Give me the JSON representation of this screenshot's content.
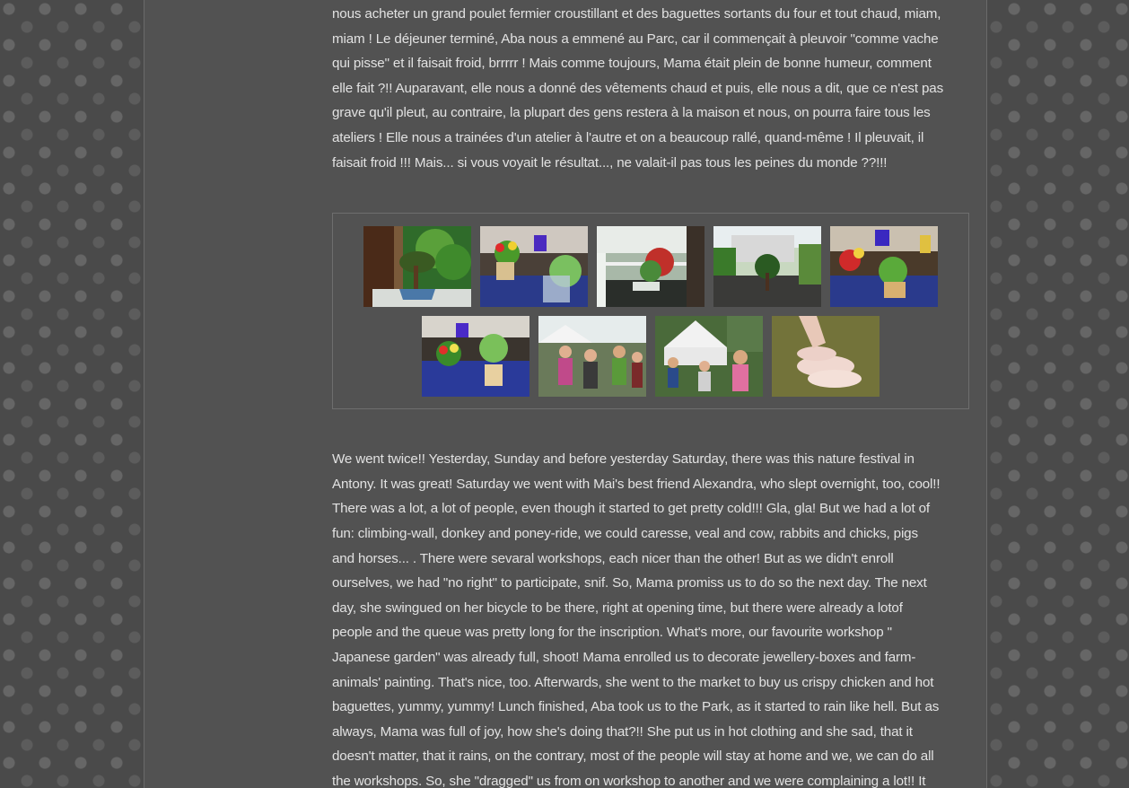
{
  "post": {
    "french_lines": [
      "nous acheter un grand poulet fermier croustillant et des baguettes sortants du four et tout chaud, miam,",
      "miam ! Le déjeuner terminé, Aba nous a emmené au Parc, car il commençait à pleuvoir \"comme vache",
      "qui pisse\" et il faisait froid, brrrrr ! Mais comme toujours, Mama était plein de bonne humeur, comment",
      "elle fait ?!! Auparavant, elle nous a donné des vêtements chaud et puis, elle nous a dit, que ce n'est pas",
      "grave qu'il pleut, au contraire, la plupart des gens restera à la maison et nous, on pourra faire tous les",
      "ateliers ! Elle nous a trainées d'un atelier à l'autre et on a beaucoup rallé, quand-même ! Il pleuvait, il",
      "faisait froid !!! Mais... si vous voyait le résultat..., ne valait-il pas tous les peines du monde ??!!!"
    ],
    "english_lines": [
      "We went twice!! Yesterday, Sunday and before yesterday Saturday, there was this nature festival in",
      "Antony. It was great! Saturday we went with Mai's best friend Alexandra, who slept overnight, too, cool!!",
      "There was a lot, a lot of people, even though it started to get pretty cold!!! Gla, gla! But we had a lot of",
      "fun: climbing-wall, donkey and poney-ride, we could caresse, veal and cow, rabbits and chicks, pigs",
      "and horses... . There were sevaral workshops, each nicer than the other! But as we didn't enroll",
      "ourselves, we had \"no right\" to participate, snif. So, Mama promiss us to do so the next day. The next",
      "day, she swingued on her bicycle to be there, right at opening time, but there were already a lotof",
      "people and the queue was pretty long for the inscription. What's more, our favourite workshop \"",
      "Japanese garden\" was already full, shoot! Mama enrolled us to decorate jewellery-boxes and farm-",
      "animals' painting. That's nice, too. Afterwards, she went to the market to buy us crispy chicken and hot",
      "baguettes, yummy, yummy! Lunch finished, Aba took us to the Park, as it started to rain like hell. But as",
      "always, Mama was full of joy, how she's doing that?!! She put us in hot clothing and she sad, that it",
      "doesn't matter, that it rains, on the contrary, most of the people will stay at home and we, we can do all",
      "the workshops. So, she \"dragged\" us from on  workshop to another and we were complaining a lot!! It"
    ]
  },
  "gallery": {
    "row1": [
      "bonsai-on-windowsill",
      "flower-pots-on-blue-cloth",
      "balcony-plant",
      "garden-bonsai",
      "potted-flowers-display"
    ],
    "row2": [
      "flower-table",
      "festival-crowd",
      "festival-crowd-tent",
      "piglets-in-straw"
    ]
  },
  "colors": {
    "background": "#4a4a4a",
    "page": "#525252",
    "text": "#e2e2e2",
    "gallery_border": "#6e6e6e"
  }
}
